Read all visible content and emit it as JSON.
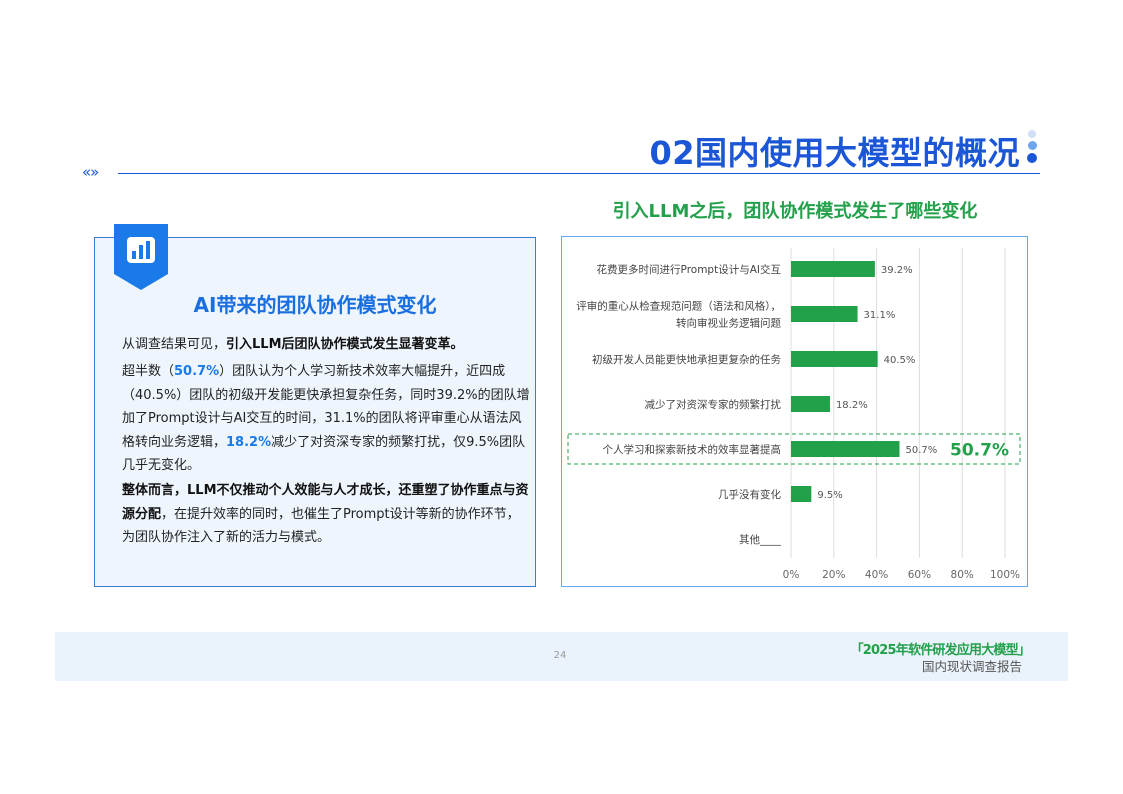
{
  "header": {
    "title": "02国内使用大模型的概况",
    "nav_arrows": "«»"
  },
  "chart_title": "引入LLM之后，团队协作模式发生了哪些变化",
  "left_panel": {
    "heading": "AI带来的团队协作模式变化",
    "icon": "bar-chart-icon",
    "p1_normal": "从调查结果可见，",
    "p1_bold": "引入LLM后团队协作模式发生显著变革。",
    "p2_a": "超半数（",
    "p2_hl1": "50.7%",
    "p2_b": "）团队认为个人学习新技术效率大幅提升，近四成（40.5%）团队的初级开发能更快承担复杂任务，同时39.2%的团队增加了Prompt设计与AI交互的时间，31.1%的团队将评审重心从语法风格转向业务逻辑，",
    "p2_hl2": "18.2%",
    "p2_c": "减少了对资深专家的频繁打扰，仅9.5%团队几乎无变化。",
    "p3_bold": "整体而言，LLM不仅推动个人效能与人才成长，还重塑了协作重点与资源分配",
    "p3_normal": "，在提升效率的同时，也催生了Prompt设计等新的协作环节，为团队协作注入了新的活力与模式。"
  },
  "chart_data": {
    "type": "bar",
    "orientation": "horizontal",
    "categories": [
      [
        "花费更多时间进行Prompt设计与AI交互"
      ],
      [
        "评审的重心从检查规范问题（语法和风格），",
        "转向审视业务逻辑问题"
      ],
      [
        "初级开发人员能更快地承担更复杂的任务"
      ],
      [
        "减少了对资深专家的频繁打扰"
      ],
      [
        "个人学习和探索新技术的效率显著提高"
      ],
      [
        "几乎没有变化"
      ],
      [
        "其他____"
      ]
    ],
    "values": [
      39.2,
      31.1,
      40.5,
      18.2,
      50.7,
      9.5,
      null
    ],
    "value_labels": [
      "39.2%",
      "31.1%",
      "40.5%",
      "18.2%",
      "50.7%",
      "9.5%",
      ""
    ],
    "highlight_index": 4,
    "highlight_label": "50.7%",
    "xlim": [
      0,
      100
    ],
    "xticks": [
      "0%",
      "20%",
      "40%",
      "60%",
      "80%",
      "100%"
    ],
    "grid": true,
    "bar_color": "#22a04a",
    "highlight_color": "#22a04a"
  },
  "footer": {
    "page_number": "24",
    "brand": "「2025年软件研发应用大模型」",
    "subtitle": "国内现状调查报告"
  },
  "colors": {
    "primary_blue": "#1a56d6",
    "accent_blue": "#1a7ae8",
    "green": "#22a04a"
  }
}
